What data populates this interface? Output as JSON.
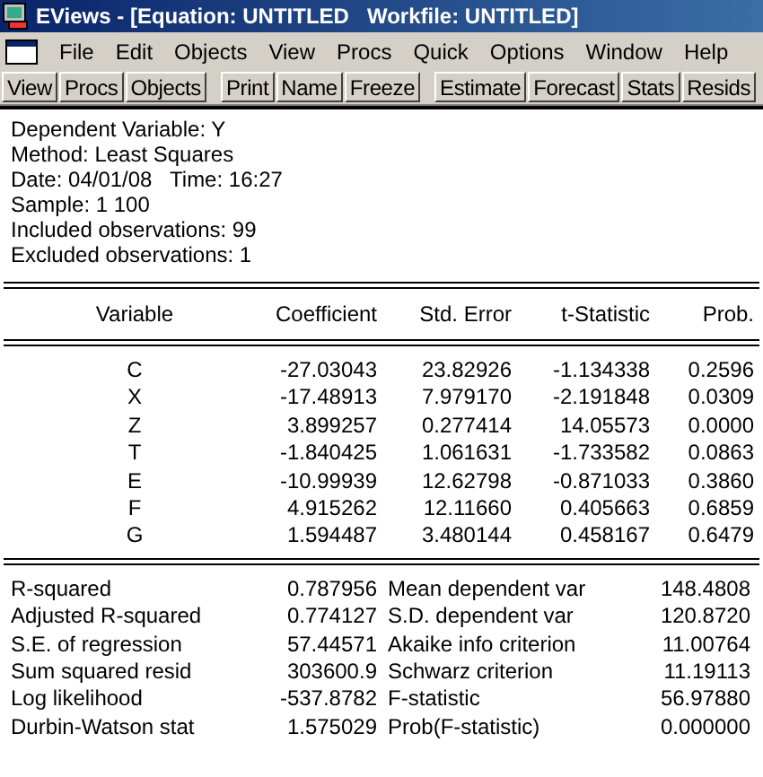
{
  "window": {
    "title": "EViews - [Equation: UNTITLED   Workfile: UNTITLED]"
  },
  "menu": [
    "File",
    "Edit",
    "Objects",
    "View",
    "Procs",
    "Quick",
    "Options",
    "Window",
    "Help"
  ],
  "toolbar_groups": [
    [
      "View",
      "Procs",
      "Objects"
    ],
    [
      "Print",
      "Name",
      "Freeze"
    ],
    [
      "Estimate",
      "Forecast",
      "Stats",
      "Resids"
    ]
  ],
  "header": [
    "Dependent Variable: Y",
    "Method: Least Squares",
    "Date: 04/01/08   Time: 16:27",
    "Sample: 1 100",
    "Included observations: 99",
    "Excluded observations: 1"
  ],
  "table": {
    "columns": [
      "Variable",
      "Coefficient",
      "Std. Error",
      "t-Statistic",
      "Prob."
    ],
    "rows": [
      [
        "C",
        "-27.03043",
        "23.82926",
        "-1.134338",
        "0.2596"
      ],
      [
        "X",
        "-17.48913",
        "7.979170",
        "-2.191848",
        "0.0309"
      ],
      [
        "Z",
        "3.899257",
        "0.277414",
        "14.05573",
        "0.0000"
      ],
      [
        "T",
        "-1.840425",
        "1.061631",
        "-1.733582",
        "0.0863"
      ],
      [
        "E",
        "-10.99939",
        "12.62798",
        "-0.871033",
        "0.3860"
      ],
      [
        "F",
        "4.915262",
        "12.11660",
        "0.405663",
        "0.6859"
      ],
      [
        "G",
        "1.594487",
        "3.480144",
        "0.458167",
        "0.6479"
      ]
    ]
  },
  "stats": [
    [
      "R-squared",
      "0.787956",
      "Mean dependent var",
      "148.4808"
    ],
    [
      "Adjusted R-squared",
      "0.774127",
      "S.D. dependent var",
      "120.8720"
    ],
    [
      "S.E. of regression",
      "57.44571",
      "Akaike info criterion",
      "11.00764"
    ],
    [
      "Sum squared resid",
      "303600.9",
      "Schwarz criterion",
      "11.19113"
    ],
    [
      "Log likelihood",
      "-537.8782",
      "F-statistic",
      "56.97880"
    ],
    [
      "Durbin-Watson stat",
      "1.575029",
      "Prob(F-statistic)",
      "0.000000"
    ]
  ]
}
